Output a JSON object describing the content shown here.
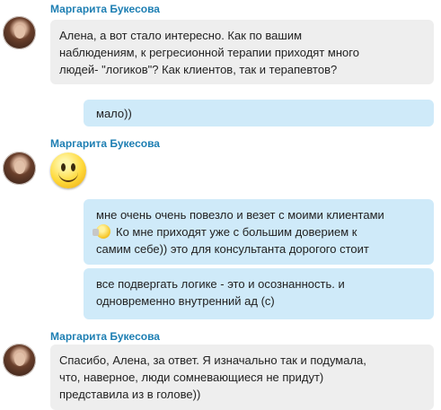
{
  "conversation": {
    "sender_name": "Маргарита Букесова",
    "messages": {
      "m1_lines": [
        "Алена, а вот стало интересно. Как по вашим",
        "наблюдениям, к регресионной терапии приходят много",
        "людей- \"логиков\"? Как клиентов, так и терапевтов?"
      ],
      "m2": "мало))",
      "m3_smiley": "smile-emoticon",
      "m4_line1": "мне очень очень повезло и везет с моими клиентами",
      "m4_line2": "Ко мне приходят уже с большим доверием к",
      "m4_line3": "самим себе)) это для консультанта дорогого стоит",
      "m4_icon": "hand-smiley-emoticon",
      "m5_lines": [
        "все подвергать логике - это и осознанность. и",
        "одновременно внутренний ад (с)"
      ],
      "m6_lines": [
        "Спасибо, Алена, за ответ. Я изначально так и подумала,",
        "что, наверное, люди сомневающиеся не придут)",
        "представила из в голове))"
      ]
    }
  },
  "colors": {
    "sender_name": "#1e7fb3",
    "incoming_bubble": "#eeeeee",
    "outgoing_bubble": "#cfeaf9",
    "text": "#222222"
  }
}
